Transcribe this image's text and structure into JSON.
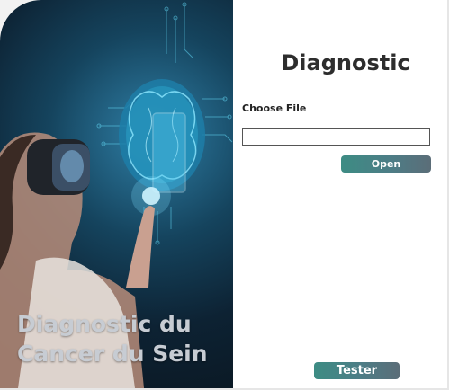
{
  "hero": {
    "title_line1": "Diagnostic du",
    "title_line2": "Cancer du Sein",
    "image_description_icons": [
      "brain-circuit-illustration",
      "vr-headset-woman-illustration"
    ]
  },
  "main": {
    "heading": "Diagnostic",
    "file_label": "Choose File",
    "file_value": "",
    "open_label": "Open",
    "test_label": "Tester"
  },
  "colors": {
    "button_start": "#3d8c84",
    "button_end": "#5b6d78",
    "hero_text": "#c7ccd3",
    "heading": "#2d2d2d"
  }
}
